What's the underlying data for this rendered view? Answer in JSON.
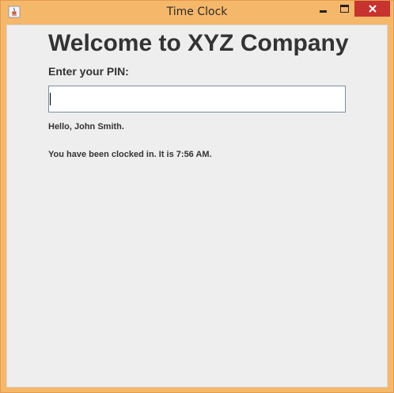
{
  "window": {
    "title": "Time Clock",
    "icon": "java-cup-icon",
    "buttons": {
      "minimize_icon": "minimize-icon",
      "maximize_icon": "maximize-icon",
      "close_icon": "close-icon",
      "close_glyph": "✕"
    },
    "accent_color": "#f5b76a",
    "close_color": "#c7332f"
  },
  "main": {
    "heading": "Welcome to XYZ Company",
    "pin_label": "Enter your PIN:",
    "pin_value": "",
    "greeting": "Hello, John Smith.",
    "status": "You have been clocked in. It is 7:56 AM."
  }
}
